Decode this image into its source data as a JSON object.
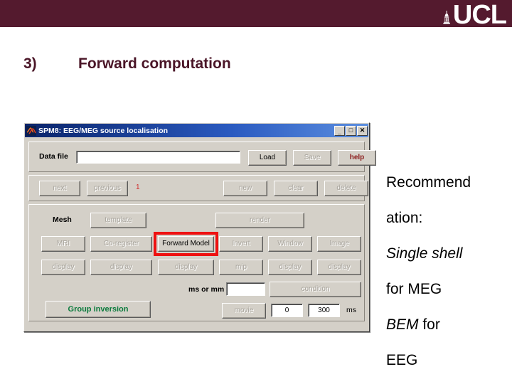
{
  "header": {
    "brand": "UCL",
    "dome_icon": "ucl-dome-icon",
    "band_color": "#541a2e"
  },
  "slide": {
    "number": "3)",
    "title": "Forward computation",
    "title_color": "#4a1527"
  },
  "spm_window": {
    "app_icon": "matlab-membrane-icon",
    "title": "SPM8: EEG/MEG source localisation",
    "controls": {
      "minimize": "_",
      "maximize": "□",
      "close": "✕"
    },
    "datafile_row": {
      "label": "Data file",
      "input_value": "",
      "input_placeholder": "",
      "load": "Load",
      "save": "Save",
      "help": "help",
      "help_color": "#8b1a1a"
    },
    "nav_row": {
      "next": "next",
      "previous": "previous",
      "index": "1",
      "index_color": "#d03030",
      "new": "new",
      "clear": "clear",
      "delete": "delete"
    },
    "mesh_row": {
      "label": "Mesh",
      "template": "template",
      "render": "render"
    },
    "model_row": {
      "mri": "MRI",
      "coregister": "Co-register",
      "forward_model": "Forward Model",
      "invert": "Invert",
      "window": "Window",
      "image": "Image",
      "highlight_color": "#ee1111"
    },
    "display_row": {
      "display1": "display",
      "display2": "display",
      "display3": "display",
      "mip": "mip",
      "display4": "display",
      "display5": "display"
    },
    "condition_row": {
      "ms_or_mm_label": "ms or mm",
      "ms_or_mm_value": "",
      "condition": "condition"
    },
    "bottom_row": {
      "group_inversion": "Group inversion",
      "group_inversion_color": "#0a7a3c",
      "movie": "movie",
      "time_start": "0",
      "time_end": "300",
      "time_unit": "ms"
    }
  },
  "recommendation": {
    "line1": "Recommend",
    "line2": "ation:",
    "line3_italic": "Single shell",
    "line4": "for MEG",
    "line5_italic": "BEM",
    "line5_rest": " for",
    "line6": "EEG"
  }
}
